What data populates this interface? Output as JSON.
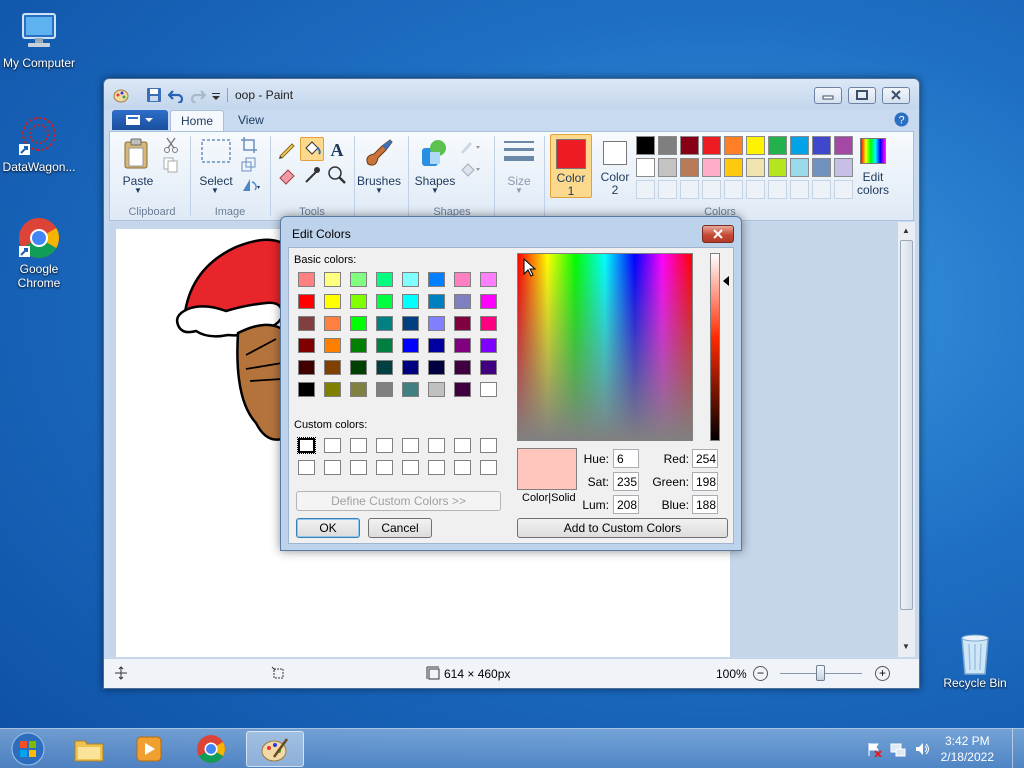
{
  "desktop": {
    "icons": [
      {
        "label": "My Computer"
      },
      {
        "label": "DataWagon..."
      },
      {
        "label": "Google Chrome"
      },
      {
        "label": "Recycle Bin"
      }
    ]
  },
  "paint": {
    "title": "oop - Paint",
    "tabs": [
      "Home",
      "View"
    ],
    "groups": {
      "clipboard": "Clipboard",
      "image": "Image",
      "tools": "Tools",
      "shapes": "Shapes",
      "colors": "Colors"
    },
    "buttons": {
      "paste": "Paste",
      "select": "Select",
      "brushes": "Brushes",
      "shapes": "Shapes",
      "size": "Size",
      "color1_line1": "Color",
      "color1_line2": "1",
      "color2_line1": "Color",
      "color2_line2": "2",
      "edit_colors_line1": "Edit",
      "edit_colors_line2": "colors"
    },
    "color1": "#ed1c24",
    "color2": "#ffffff",
    "palette_row1": [
      "#000000",
      "#7f7f7f",
      "#880015",
      "#ed1c24",
      "#ff7f27",
      "#fff200",
      "#22b14c",
      "#00a2e8",
      "#3f48cc",
      "#a349a4"
    ],
    "palette_row2": [
      "#ffffff",
      "#c3c3c3",
      "#b97a57",
      "#ffaec9",
      "#ffc90e",
      "#efe4b0",
      "#b5e61d",
      "#99d9ea",
      "#7092be",
      "#c8bfe7"
    ],
    "status": {
      "dimensions": "614 × 460px",
      "zoom": "100%"
    }
  },
  "dialog": {
    "title": "Edit Colors",
    "basic_colors_label": "Basic colors:",
    "custom_colors_label": "Custom colors:",
    "define_button": "Define Custom Colors >>",
    "ok": "OK",
    "cancel": "Cancel",
    "add_button": "Add to Custom Colors",
    "color_solid_label": "Color|Solid",
    "preview_color": "#fec6bc",
    "fields": {
      "hue_label": "Hue:",
      "hue": "6",
      "sat_label": "Sat:",
      "sat": "235",
      "lum_label": "Lum:",
      "lum": "208",
      "red_label": "Red:",
      "red": "254",
      "green_label": "Green:",
      "green": "198",
      "blue_label": "Blue:",
      "blue": "188"
    },
    "basic_colors": [
      [
        "#ff8080",
        "#ffff80",
        "#80ff80",
        "#00ff80",
        "#80ffff",
        "#0080ff",
        "#ff80c0",
        "#ff80ff"
      ],
      [
        "#ff0000",
        "#ffff00",
        "#80ff00",
        "#00ff40",
        "#00ffff",
        "#0080c0",
        "#8080c0",
        "#ff00ff"
      ],
      [
        "#804040",
        "#ff8040",
        "#00ff00",
        "#008080",
        "#004080",
        "#8080ff",
        "#800040",
        "#ff0080"
      ],
      [
        "#800000",
        "#ff8000",
        "#008000",
        "#008040",
        "#0000ff",
        "#0000a0",
        "#800080",
        "#8000ff"
      ],
      [
        "#400000",
        "#804000",
        "#004000",
        "#004040",
        "#000080",
        "#000040",
        "#400040",
        "#400080"
      ],
      [
        "#000000",
        "#808000",
        "#808040",
        "#808080",
        "#408080",
        "#c0c0c0",
        "#400040",
        "#ffffff"
      ]
    ]
  },
  "taskbar": {
    "time": "3:42 PM",
    "date": "2/18/2022"
  }
}
